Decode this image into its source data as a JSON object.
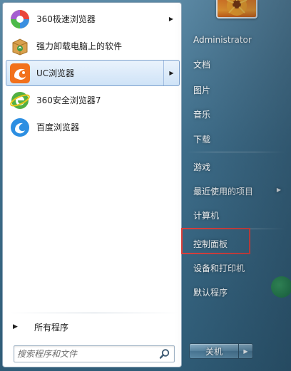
{
  "programs": [
    {
      "label": "360极速浏览器",
      "icon": "360-speed-browser-icon",
      "has_submenu": true,
      "selected": false
    },
    {
      "label": "强力卸载电脑上的软件",
      "icon": "uninstaller-box-icon",
      "has_submenu": false,
      "selected": false
    },
    {
      "label": "UC浏览器",
      "icon": "uc-browser-icon",
      "has_submenu": true,
      "selected": true
    },
    {
      "label": "360安全浏览器7",
      "icon": "360-safe-browser-icon",
      "has_submenu": false,
      "selected": false
    },
    {
      "label": "百度浏览器",
      "icon": "baidu-browser-icon",
      "has_submenu": false,
      "selected": false
    }
  ],
  "all_programs": {
    "label": "所有程序"
  },
  "search": {
    "placeholder": "搜索程序和文件"
  },
  "right_menu": [
    {
      "label": "Administrator"
    },
    {
      "label": "文档"
    },
    {
      "label": "图片"
    },
    {
      "label": "音乐"
    },
    {
      "label": "下载"
    },
    {
      "label": "游戏"
    },
    {
      "label": "最近使用的项目",
      "has_submenu": true
    },
    {
      "label": "计算机"
    },
    {
      "label": "控制面板",
      "highlighted": true
    },
    {
      "label": "设备和打印机"
    },
    {
      "label": "默认程序"
    }
  ],
  "shutdown": {
    "label": "关机"
  },
  "colors": {
    "highlight_box": "#e0403c",
    "selected_item": "#cfe3f7",
    "panel_blue": "#3f6f8c"
  }
}
